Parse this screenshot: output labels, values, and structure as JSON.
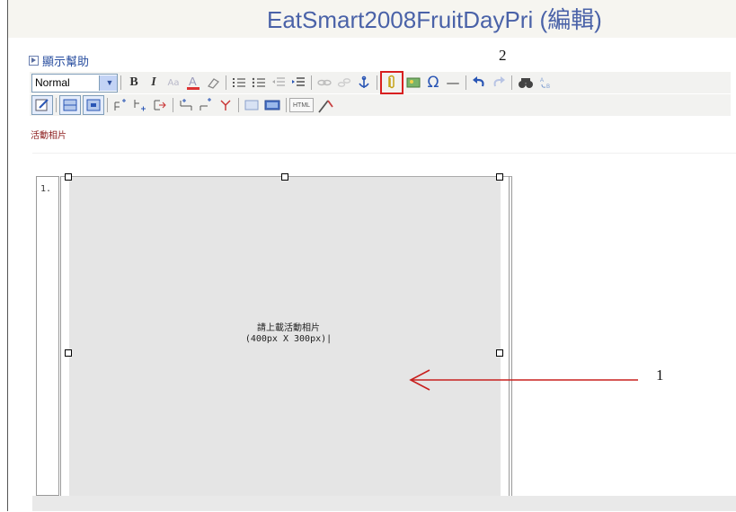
{
  "window": {
    "title": "EatSmart2008FruitDayPri (編輯)"
  },
  "help": {
    "label": "顯示幫助"
  },
  "annotations": {
    "marker_2": "2",
    "marker_1": "1"
  },
  "toolbar_row1": {
    "format_select": {
      "value": "Normal"
    },
    "buttons": [
      {
        "name": "bold-button",
        "icon": "B"
      },
      {
        "name": "italic-button",
        "icon": "I"
      },
      {
        "name": "font-size-button",
        "icon": "Aa"
      },
      {
        "name": "font-color-button",
        "icon": "A"
      },
      {
        "name": "eraser-button",
        "icon": "eraser"
      },
      {
        "name": "ordered-list-button",
        "icon": "ordered-list"
      },
      {
        "name": "unordered-list-button",
        "icon": "unordered-list"
      },
      {
        "name": "outdent-button",
        "icon": "outdent"
      },
      {
        "name": "indent-button",
        "icon": "indent"
      },
      {
        "name": "link-button",
        "icon": "link"
      },
      {
        "name": "unlink-button",
        "icon": "unlink"
      },
      {
        "name": "anchor-button",
        "icon": "anchor"
      },
      {
        "name": "attach-file-button",
        "icon": "paperclip",
        "highlighted": true
      },
      {
        "name": "insert-image-button",
        "icon": "image"
      },
      {
        "name": "special-char-button",
        "icon": "omega",
        "glyph": "Ω"
      },
      {
        "name": "horizontal-rule-button",
        "icon": "rule",
        "glyph": "—"
      },
      {
        "name": "undo-button",
        "icon": "undo"
      },
      {
        "name": "redo-button",
        "icon": "redo"
      },
      {
        "name": "find-button",
        "icon": "binoculars"
      },
      {
        "name": "replace-button",
        "icon": "replace"
      }
    ]
  },
  "toolbar_row2": {
    "html_button": "HTML"
  },
  "editor": {
    "section_label": "活動相片",
    "line_number": "1.",
    "cell_text_line1": "請上載活動相片",
    "cell_text_line2": "(400px X 300px)|"
  },
  "colors": {
    "title": "#4a62a8",
    "help_link": "#2a4fa0",
    "annotation_box": "#d82020",
    "annotation_arrow": "#c8201e",
    "cell_background": "#e5e5e5"
  }
}
